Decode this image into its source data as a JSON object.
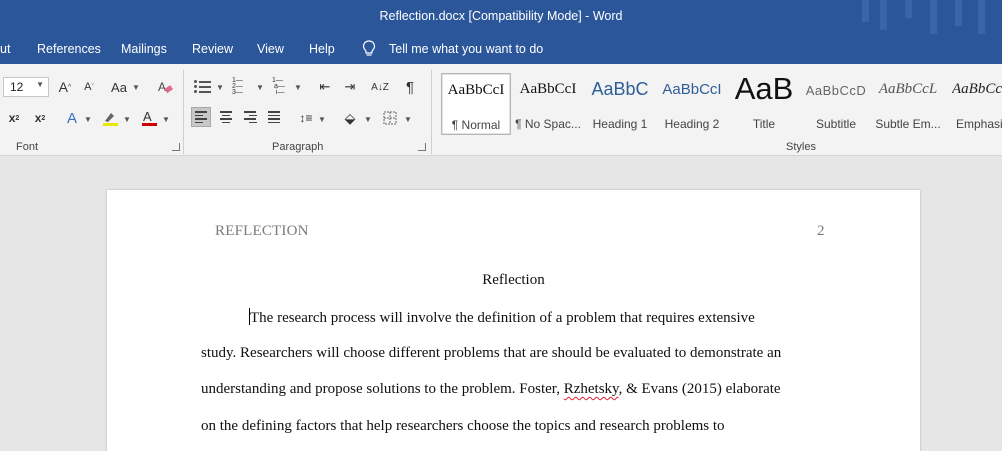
{
  "window": {
    "title": "Reflection.docx [Compatibility Mode]  -  Word"
  },
  "menu": {
    "tabs": [
      "ut",
      "References",
      "Mailings",
      "Review",
      "View",
      "Help"
    ],
    "tell_me": "Tell me what you want to do"
  },
  "ribbon": {
    "font_size": "12",
    "font_group_label": "Font",
    "paragraph_group_label": "Paragraph",
    "styles_group_label": "Styles",
    "styles": [
      {
        "sample": "AaBbCcI",
        "name": "¶ Normal"
      },
      {
        "sample": "AaBbCcI",
        "name": "¶ No Spac..."
      },
      {
        "sample": "AaBbC",
        "name": "Heading 1"
      },
      {
        "sample": "AaBbCcI",
        "name": "Heading 2"
      },
      {
        "sample": "AaB",
        "name": "Title"
      },
      {
        "sample": "AaBbCcD",
        "name": "Subtitle"
      },
      {
        "sample": "AaBbCcL",
        "name": "Subtle Em..."
      },
      {
        "sample": "AaBbCcL",
        "name": "Emphasis"
      }
    ],
    "selected_style": "Normal",
    "accent_highlight": "#e8e800",
    "accent_font_color": "#d00000"
  },
  "document": {
    "running_head": "REFLECTION",
    "page_number": "2",
    "title": "Reflection",
    "lines": [
      "The research process will involve the definition of a problem that requires extensive",
      "study. Researchers will choose different problems that are should be evaluated to demonstrate an",
      "understanding and propose solutions to the problem. Foster, ",
      "on the defining factors that help researchers choose the topics and research problems to"
    ],
    "misspelled_word": "Rzhetsky",
    "line3_tail": ", & Evans (2015) elaborate"
  }
}
